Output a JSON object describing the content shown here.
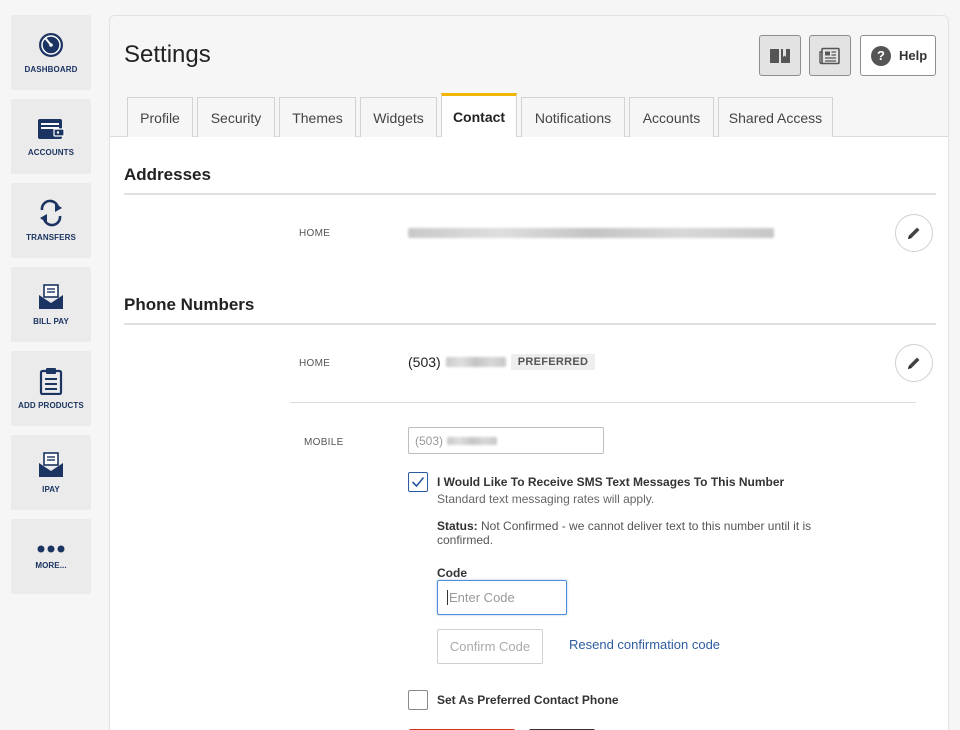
{
  "sidebar": {
    "items": [
      {
        "label": "DASHBOARD",
        "icon": "dashboard-gauge-icon"
      },
      {
        "label": "ACCOUNTS",
        "icon": "wallet-icon"
      },
      {
        "label": "TRANSFERS",
        "icon": "transfer-arrows-icon"
      },
      {
        "label": "BILL PAY",
        "icon": "bill-envelope-icon"
      },
      {
        "label": "ADD PRODUCTS",
        "icon": "clipboard-icon"
      },
      {
        "label": "IPAY",
        "icon": "ipay-envelope-icon"
      },
      {
        "label": "MORE...",
        "icon": "more-dots-icon"
      }
    ]
  },
  "header": {
    "title": "Settings",
    "help_label": "Help",
    "help_symbol": "?"
  },
  "tabs": [
    {
      "label": "Profile",
      "active": false
    },
    {
      "label": "Security",
      "active": false
    },
    {
      "label": "Themes",
      "active": false
    },
    {
      "label": "Widgets",
      "active": false
    },
    {
      "label": "Contact",
      "active": true
    },
    {
      "label": "Notifications",
      "active": false
    },
    {
      "label": "Accounts",
      "active": false
    },
    {
      "label": "Shared Access",
      "active": false
    }
  ],
  "addresses": {
    "title": "Addresses",
    "home_label": "HOME"
  },
  "phones": {
    "title": "Phone Numbers",
    "home_label": "HOME",
    "home_area_code": "(503)",
    "preferred_badge": "PREFERRED",
    "mobile_label": "MOBILE",
    "mobile_area_code": "(503)",
    "sms_checkbox_label": "I Would Like To Receive SMS Text Messages To This Number",
    "sms_checked": true,
    "sms_note": "Standard text messaging rates will apply.",
    "status_label": "Status:",
    "status_text": "Not Confirmed - we cannot deliver text to this number until it is confirmed.",
    "code_label": "Code",
    "code_placeholder": "Enter Code",
    "confirm_button": "Confirm Code",
    "resend_link": "Resend confirmation code",
    "preferred_checkbox_label": "Set As Preferred Contact Phone",
    "preferred_checked": false
  },
  "colors": {
    "nav_text": "#1b3461",
    "active_tab_accent": "#f2b705",
    "link": "#2e5d9f",
    "primary_red": "#d03524"
  }
}
